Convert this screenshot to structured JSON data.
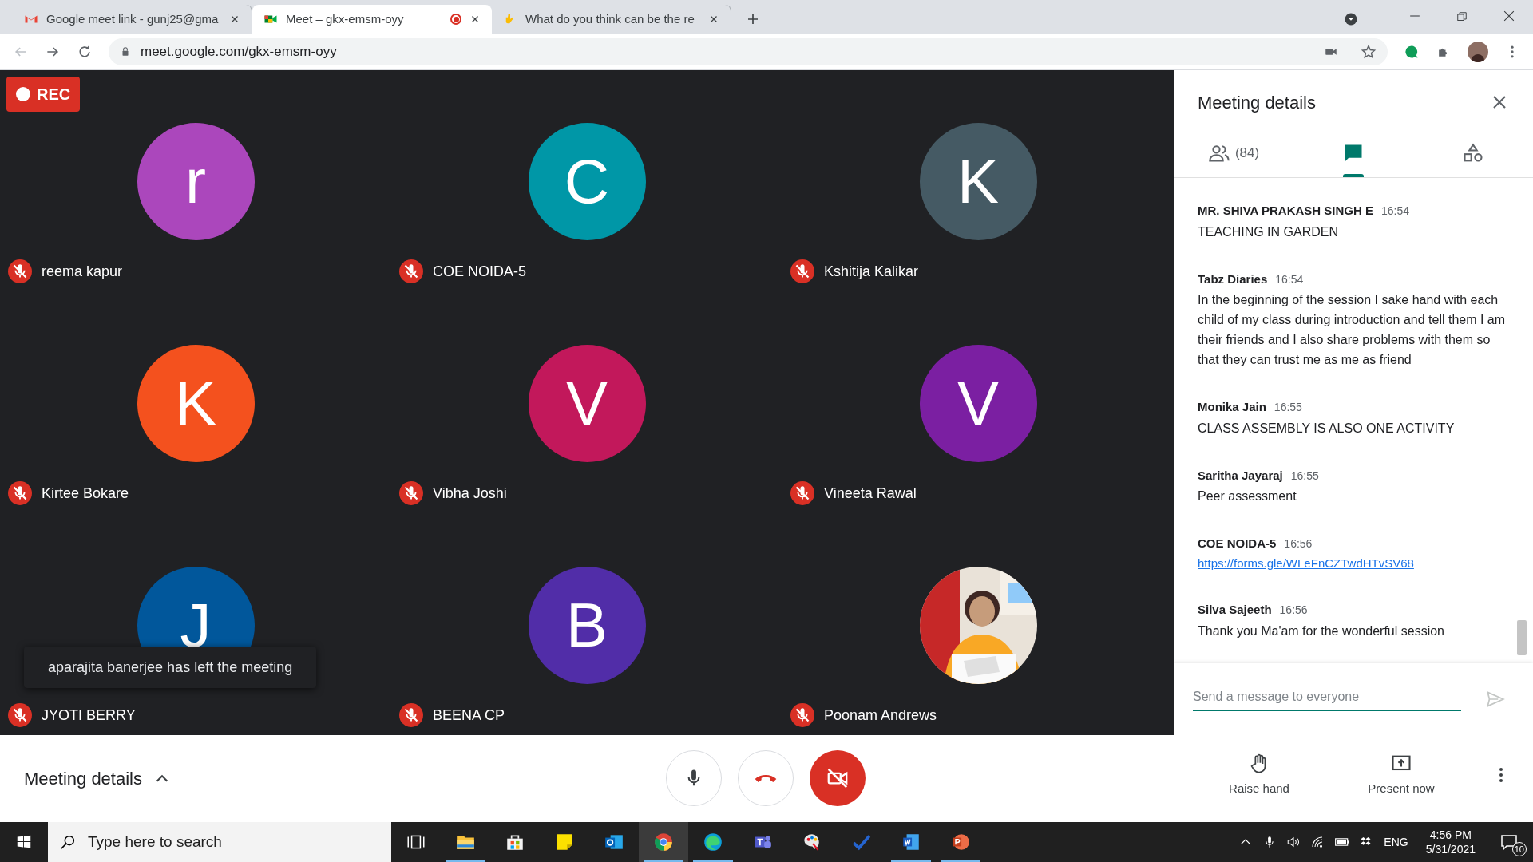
{
  "browser": {
    "tabs": [
      {
        "kind": "mail",
        "title": "Google meet link - gunj25@gma",
        "selected": false,
        "recording": false
      },
      {
        "kind": "meet",
        "title": "Meet – gkx-emsm-oyy",
        "selected": true,
        "recording": true
      },
      {
        "kind": "hand",
        "title": "What do you think can be the re",
        "selected": false,
        "recording": false
      }
    ],
    "url": "meet.google.com/gkx-emsm-oyy"
  },
  "meeting": {
    "rec_badge": "REC",
    "participants": [
      {
        "kind": "initial",
        "initial": "r",
        "name": "reema kapur",
        "color": "#ab47bc",
        "muted": true
      },
      {
        "kind": "initial",
        "initial": "C",
        "name": "COE NOIDA-5",
        "color": "#0097a7",
        "muted": true
      },
      {
        "kind": "initial",
        "initial": "K",
        "name": "Kshitija Kalikar",
        "color": "#455a64",
        "muted": true
      },
      {
        "kind": "initial",
        "initial": "K",
        "name": "Kirtee Bokare",
        "color": "#f4511e",
        "muted": true
      },
      {
        "kind": "initial",
        "initial": "V",
        "name": "Vibha Joshi",
        "color": "#c2185b",
        "muted": true
      },
      {
        "kind": "initial",
        "initial": "V",
        "name": "Vineeta Rawal",
        "color": "#7b1fa2",
        "muted": true
      },
      {
        "kind": "initial",
        "initial": "J",
        "name": "JYOTI BERRY",
        "color": "#01579b",
        "muted": true
      },
      {
        "kind": "initial",
        "initial": "B",
        "name": "BEENA CP",
        "color": "#512da8",
        "muted": true
      },
      {
        "kind": "picture",
        "name": "Poonam Andrews",
        "muted": true
      }
    ],
    "toast": "aparajita banerjee has left the meeting"
  },
  "panel": {
    "title": "Meeting details",
    "tabs": [
      {
        "kind": "people",
        "label": "(84)",
        "selected": false
      },
      {
        "kind": "chat",
        "selected": true
      },
      {
        "kind": "activities",
        "selected": false
      }
    ],
    "messages": [
      {
        "sender": "MR. SHIVA PRAKASH SINGH E",
        "time": "16:54",
        "kind": "text",
        "text": "TEACHING IN GARDEN"
      },
      {
        "sender": "Tabz Diaries",
        "time": "16:54",
        "kind": "text",
        "text": "In the beginning of the session I sake hand with each child of my class during introduction and tell them I am their friends and I also share problems with them so that they can trust me as me as friend"
      },
      {
        "sender": "Monika Jain",
        "time": "16:55",
        "kind": "text",
        "text": "CLASS ASSEMBLY IS ALSO ONE ACTIVITY"
      },
      {
        "sender": "Saritha Jayaraj",
        "time": "16:55",
        "kind": "text",
        "text": "Peer assessment"
      },
      {
        "sender": "COE NOIDA-5",
        "time": "16:56",
        "kind": "link",
        "text": "https://forms.gle/WLeFnCZTwdHTvSV68"
      },
      {
        "sender": "Silva Sajeeth",
        "time": "16:56",
        "kind": "text",
        "text": "Thank you Ma'am for the wonderful session"
      }
    ],
    "placeholder": "Send a message to everyone"
  },
  "controls": {
    "details_label": "Meeting details",
    "mic_on": true,
    "camera_on": false,
    "raise_hand": "Raise hand",
    "present_now": "Present now"
  },
  "taskbar": {
    "search_placeholder": "Type here to search",
    "apps": [
      {
        "kind": "taskview",
        "open": false,
        "selected": false
      },
      {
        "kind": "explorer",
        "open": true,
        "selected": false
      },
      {
        "kind": "store",
        "open": false,
        "selected": false
      },
      {
        "kind": "sticky",
        "open": false,
        "selected": false
      },
      {
        "kind": "outlook",
        "open": false,
        "selected": false
      },
      {
        "kind": "chrome",
        "open": true,
        "selected": true
      },
      {
        "kind": "edge",
        "open": true,
        "selected": false
      },
      {
        "kind": "teams",
        "open": false,
        "selected": false
      },
      {
        "kind": "paint",
        "open": false,
        "selected": false
      },
      {
        "kind": "todo",
        "open": false,
        "selected": false
      },
      {
        "kind": "word",
        "open": true,
        "selected": false
      },
      {
        "kind": "powerpoint",
        "open": true,
        "selected": false
      }
    ],
    "language": "ENG",
    "time": "4:56 PM",
    "date": "5/31/2021",
    "notifications": "10"
  }
}
